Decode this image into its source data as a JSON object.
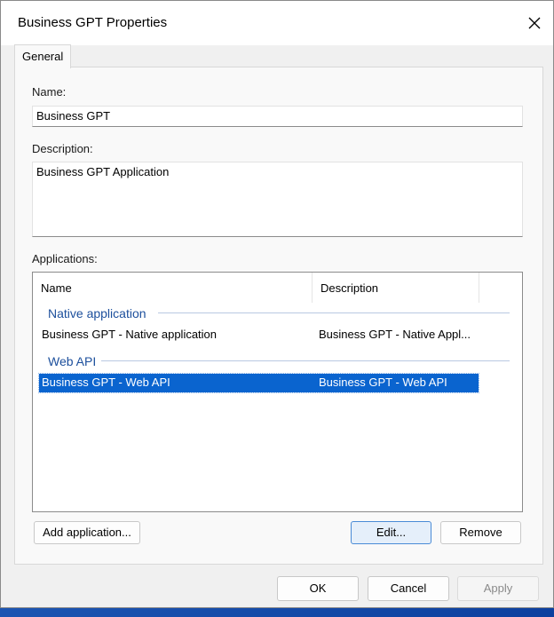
{
  "window": {
    "title": "Business GPT Properties"
  },
  "tabs": [
    {
      "label": "General",
      "selected": true
    }
  ],
  "form": {
    "name_label": "Name:",
    "name_value": "Business GPT",
    "description_label": "Description:",
    "description_value": "Business GPT Application",
    "applications_label": "Applications:"
  },
  "applications": {
    "columns": [
      "Name",
      "Description"
    ],
    "groups": [
      {
        "label": "Native application",
        "rows": [
          {
            "name": "Business GPT - Native application",
            "description": "Business GPT - Native Appl...",
            "selected": false
          }
        ]
      },
      {
        "label": "Web API",
        "rows": [
          {
            "name": "Business GPT - Web API",
            "description": "Business GPT - Web API",
            "selected": true
          }
        ]
      }
    ]
  },
  "buttons": {
    "add_application": "Add application...",
    "edit": "Edit...",
    "remove": "Remove",
    "ok": "OK",
    "cancel": "Cancel",
    "apply": "Apply"
  },
  "icons": {
    "close": "close-icon"
  },
  "colors": {
    "selection": "#0a64cf",
    "group_label": "#1c4f9c",
    "window_bg": "#f0f0f0",
    "panel_bg": "#f9f9f9"
  }
}
